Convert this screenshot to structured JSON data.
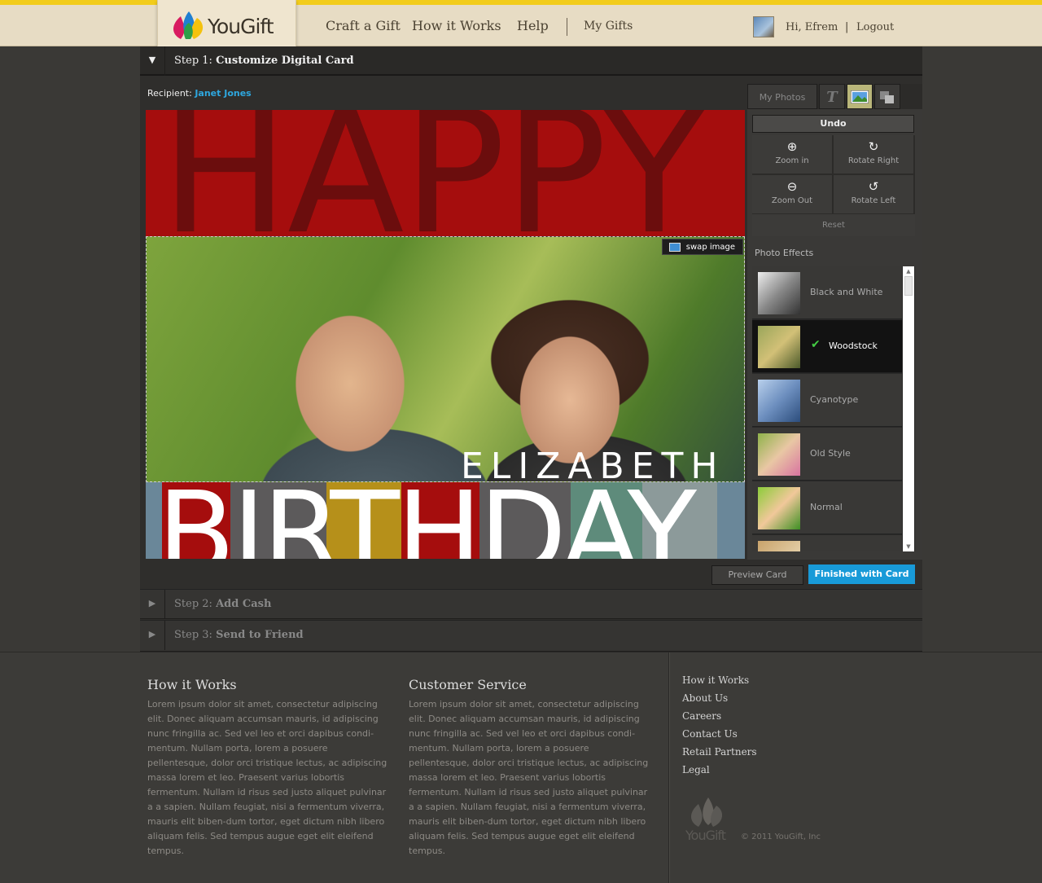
{
  "header": {
    "logo_text": "YouGift",
    "nav": [
      "Craft a Gift",
      "How it Works",
      "Help"
    ],
    "my_gifts": "My Gifts",
    "greeting": "Hi, Efrem",
    "separator": "|",
    "logout": "Logout"
  },
  "steps": {
    "step1": {
      "prefix": "Step 1:",
      "title": "Customize Digital Card"
    },
    "step2": {
      "prefix": "Step 2:",
      "title": "Add Cash"
    },
    "step3": {
      "prefix": "Step 3:",
      "title": "Send to Friend"
    }
  },
  "recipient": {
    "label": "Recipient:",
    "name": "Janet Jones"
  },
  "card": {
    "happy": "HAPPY",
    "name": "ELIZABETH",
    "birthday": "BIRTHDAY",
    "swap_label": "swap image"
  },
  "tools": {
    "tabs": {
      "my_photos": "My Photos",
      "text_icon": "T"
    },
    "undo": "Undo",
    "zoom_in": "Zoom in",
    "rotate_right": "Rotate Right",
    "zoom_out": "Zoom Out",
    "rotate_left": "Rotate Left",
    "reset": "Reset",
    "effects_label": "Photo Effects",
    "effects": [
      {
        "name": "Black and White",
        "selected": false
      },
      {
        "name": "Woodstock",
        "selected": true
      },
      {
        "name": "Cyanotype",
        "selected": false
      },
      {
        "name": "Old Style",
        "selected": false
      },
      {
        "name": "Normal",
        "selected": false
      }
    ]
  },
  "actions": {
    "preview": "Preview Card",
    "finished": "Finished with Card"
  },
  "footer": {
    "how_title": "How it Works",
    "how_body": "Lorem ipsum dolor sit amet, consectetur adipiscing elit. Donec aliquam accumsan mauris, id adipiscing nunc fringilla ac. Sed vel leo et orci dapibus condi-mentum. Nullam porta, lorem a posuere pellentesque, dolor orci tristique lectus, ac adipiscing massa lorem et leo. Praesent varius lobortis fermentum. Nullam id risus sed justo aliquet pulvinar a a sapien. Nullam feugiat, nisi a fermentum viverra, mauris elit biben-dum tortor, eget dictum nibh libero aliquam felis. Sed tempus augue eget elit eleifend tempus.",
    "cs_title": "Customer Service",
    "cs_body": "Lorem ipsum dolor sit amet, consectetur adipiscing elit. Donec aliquam accumsan mauris, id adipiscing nunc fringilla ac. Sed vel leo et orci dapibus condi-mentum. Nullam porta, lorem a posuere pellentesque, dolor orci tristique lectus, ac adipiscing massa lorem et leo. Praesent varius lobortis fermentum. Nullam id risus sed justo aliquet pulvinar a a sapien. Nullam feugiat, nisi a fermentum viverra, mauris elit biben-dum tortor, eget dictum nibh libero aliquam felis. Sed tempus augue eget elit eleifend tempus.",
    "links": [
      "How it Works",
      "About Us",
      "Careers",
      "Contact Us",
      "Retail Partners",
      "Legal"
    ],
    "logo_text": "YouGift",
    "copyright": "© 2011 YouGift, Inc"
  },
  "colors": {
    "accent": "#189ad8",
    "topbar_stripe": "#f2cc1b",
    "happy_bg": "#a50d0d"
  }
}
